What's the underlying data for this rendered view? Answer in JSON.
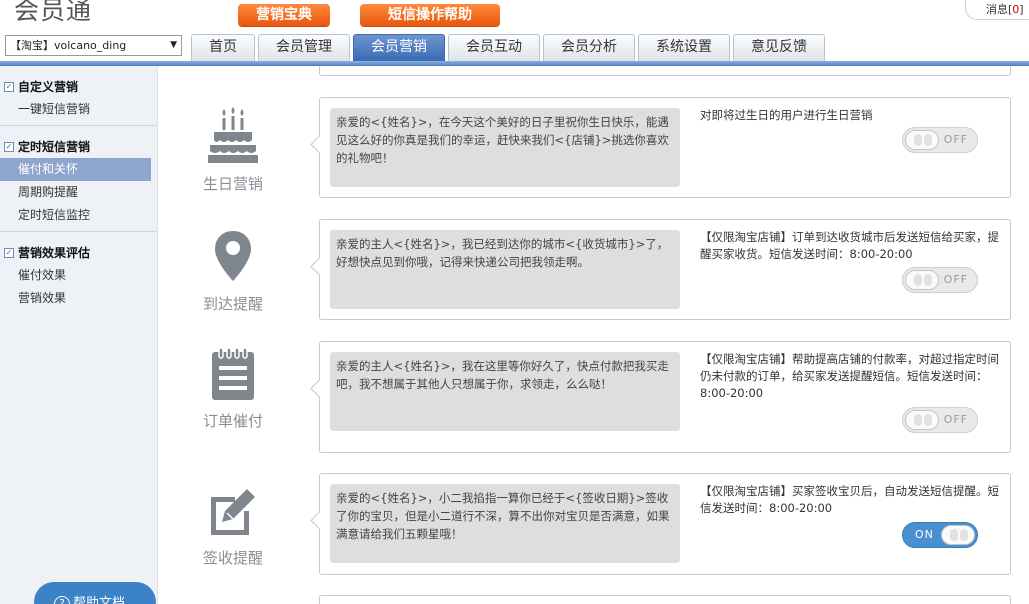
{
  "app": {
    "title": "会员通"
  },
  "promos": [
    "营销宝典",
    "短信操作帮助"
  ],
  "messages": {
    "label": "消息",
    "count": "0"
  },
  "shop_select": {
    "value": "【淘宝】volcano_ding"
  },
  "nav": {
    "tabs": [
      "首页",
      "会员管理",
      "会员营销",
      "会员互动",
      "会员分析",
      "系统设置",
      "意见反馈"
    ],
    "active": "会员营销"
  },
  "sidebar": {
    "groups": [
      {
        "title": "自定义营销",
        "items": [
          "一键短信营销"
        ]
      },
      {
        "title": "定时短信营销",
        "items": [
          "催付和关怀",
          "周期购提醒",
          "定时短信监控"
        ]
      },
      {
        "title": "营销效果评估",
        "items": [
          "催付效果",
          "营销效果"
        ]
      }
    ],
    "active_item": "催付和关怀",
    "help_button": "帮助文档"
  },
  "features": [
    {
      "name": "生日营销",
      "icon": "birthday-cake-icon",
      "sms": "亲爱的<{姓名}>，在今天这个美好的日子里祝你生日快乐，能遇见这么好的你真是我们的幸运，赶快来我们<{店铺}>挑选你喜欢的礼物吧！",
      "desc": "对即将过生日的用户进行生日营销",
      "toggle": "OFF"
    },
    {
      "name": "到达提醒",
      "icon": "location-pin-icon",
      "sms": "亲爱的主人<{姓名}>，我已经到达你的城市<{收货城市}>了，好想快点见到你哦，记得来快递公司把我领走啊。",
      "desc": "【仅限淘宝店铺】订单到达收货城市后发送短信给买家，提醒买家收货。短信发送时间：8:00-20:00",
      "toggle": "OFF"
    },
    {
      "name": "订单催付",
      "icon": "notepad-icon",
      "sms": "亲爱的主人<{姓名}>，我在这里等你好久了，快点付款把我买走吧，我不想属于其他人只想属于你，求领走，么么哒！",
      "desc": "【仅限淘宝店铺】帮助提高店铺的付款率，对超过指定时间仍未付款的订单，给买家发送提醒短信。短信发送时间：8:00-20:00",
      "toggle": "OFF"
    },
    {
      "name": "签收提醒",
      "icon": "edit-icon",
      "sms": "亲爱的<{姓名}>，小二我掐指一算你已经于<{签收日期}>签收了你的宝贝，但是小二道行不深，算不出你对宝贝是否满意，如果满意请给我们五颗星哦！",
      "desc": "【仅限淘宝店铺】买家签收宝贝后，自动发送短信提醒。短信发送时间：8:00-20:00",
      "toggle": "ON"
    }
  ]
}
